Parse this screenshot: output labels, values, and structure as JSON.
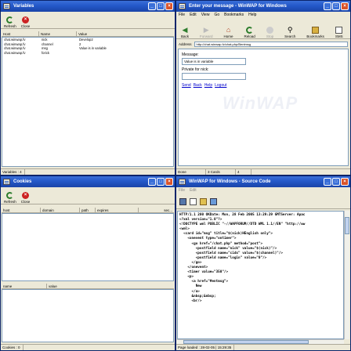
{
  "variables": {
    "title": "Variables",
    "toolbar": {
      "refresh": "Refresh",
      "close": "Close"
    },
    "columns": [
      "Host",
      "Name",
      "Value"
    ],
    "rows": [
      [
        "chat.winwap.fv",
        "nick",
        "Develop2"
      ],
      [
        "chat.winwap.fv",
        "channel",
        "2"
      ],
      [
        "chat.winwap.fv",
        "msg",
        "Value is in variable"
      ],
      [
        "chat.winwap.fv",
        "forick",
        ""
      ]
    ],
    "status": "Variables : 4"
  },
  "wap": {
    "title": "Enter your message - WinWAP for Windows",
    "menu": [
      "File",
      "Edit",
      "View",
      "Go",
      "Bookmarks",
      "Help"
    ],
    "toolbar": [
      "Back",
      "Forward",
      "Home",
      "Reload",
      "Stop",
      "Search",
      "Bookmarks",
      "SMS"
    ],
    "address_label": "Address",
    "address": "http://chat.winwap.fv/chat.php/Bentmsg",
    "message_label": "Message:",
    "message_value": "Value is in variable",
    "private_label": "Private for nick:",
    "private_value": "",
    "links": [
      "Send",
      "Back",
      "Help",
      "Logout"
    ],
    "watermark": "WinWAP",
    "status": [
      "Done",
      "3 Cards",
      "4"
    ]
  },
  "cookies": {
    "title": "Cookies",
    "toolbar": {
      "refresh": "Refresh",
      "close": "Close"
    },
    "columns": [
      "host",
      "domain",
      "path",
      "expires",
      "sec..."
    ],
    "columns2": [
      "name",
      "value"
    ],
    "status": "Cookies : 0"
  },
  "source": {
    "title": "WinWAP for Windows - Source Code",
    "menu": [
      "File",
      "Edit"
    ],
    "lines": [
      "HTTP/1.1 200 OKDate: Mon, 28 Feb 2005 13:29:29 GMTServer: Apac",
      "<?xml version=\"1.0\"?>",
      "<!DOCTYPE wml PUBLIC \"-//WAPFORUM//DTD WML 1.1//EN\" \"http://ww",
      "<wml>",
      "  <card id=\"msg\" title=\"$(nick)HEnglish only\">",
      "    <onevent type=\"ontimer\">",
      "      <go href=\"/chat.php\" method=\"post\">",
      "        <postfield name=\"nick\" value=\"$(nick)\"/>",
      "        <postfield name=\"cidx\" value=\"$(channel)\"/>",
      "        <postfield name=\"login\" value=\"0\"/>",
      "      </go>",
      "    </onevent>",
      "    <timer value=\"350\"/>",
      "    <p>",
      "      <a href=\"#entmsg\">",
      "        New",
      "      </a>",
      "      &nbsp;&nbsp;",
      "      <br/>"
    ],
    "status": "Page loaded : 28-02-05 | 15:29:35"
  }
}
